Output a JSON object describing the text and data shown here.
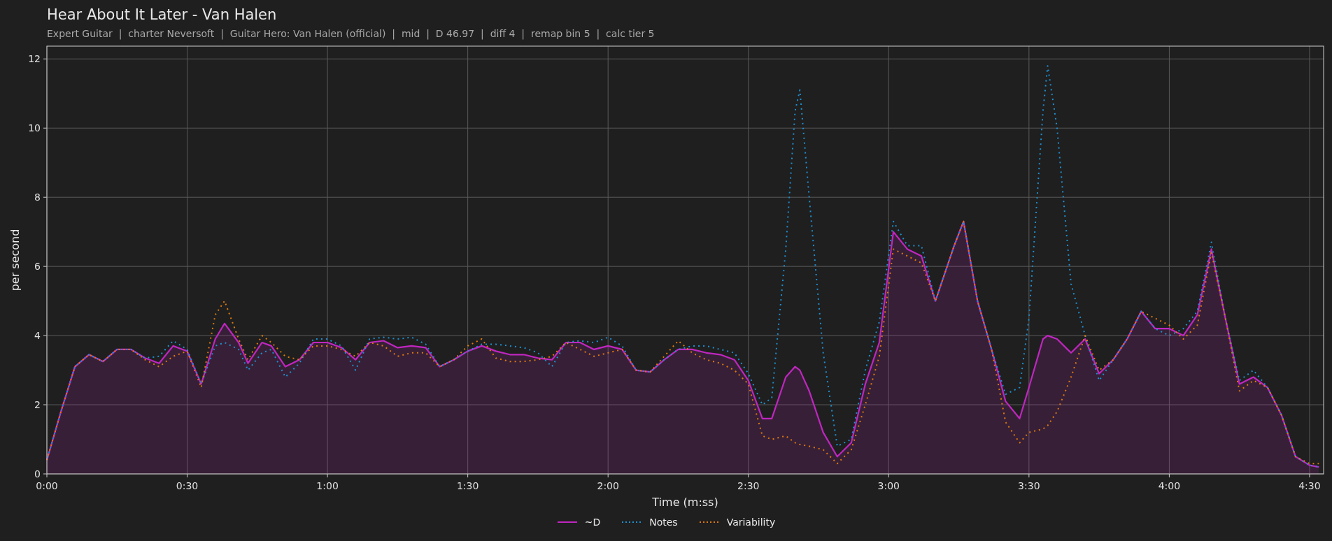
{
  "chart": {
    "subtitle": "Expert Guitar  |  charter Neversoft  |  Guitar Hero: Van Halen (official)  |  mid  |  D 46.97  |  diff 4  |  remap bin 5  |  calc tier 5",
    "chart_data": {
      "type": "line",
      "grid": true,
      "title": "Hear About It Later - Van Halen",
      "xlabel": "Time (m:ss)",
      "ylabel": "per second",
      "x": [
        0,
        3,
        6,
        9,
        12,
        15,
        18,
        21,
        24,
        27,
        30,
        33,
        36,
        38,
        41,
        43,
        46,
        48,
        51,
        54,
        57,
        60,
        63,
        66,
        69,
        72,
        75,
        78,
        81,
        84,
        87,
        90,
        93,
        96,
        99,
        102,
        105,
        108,
        111,
        114,
        117,
        120,
        123,
        126,
        129,
        132,
        135,
        138,
        141,
        144,
        147,
        150,
        153,
        155,
        158,
        160,
        161,
        163,
        166,
        169,
        172,
        175,
        178,
        181,
        184,
        187,
        190,
        194,
        196,
        199,
        202,
        205,
        208,
        210,
        213,
        214,
        216,
        219,
        222,
        225,
        228,
        231,
        234,
        237,
        240,
        243,
        246,
        249,
        252,
        255,
        258,
        261,
        264,
        267,
        270,
        272
      ],
      "series": [
        {
          "name": "~D",
          "color": "#c026c0",
          "type": "area",
          "line_style": "solid",
          "values": [
            0.4,
            1.8,
            3.1,
            3.45,
            3.25,
            3.6,
            3.6,
            3.35,
            3.2,
            3.7,
            3.55,
            2.6,
            3.9,
            4.35,
            3.8,
            3.2,
            3.8,
            3.7,
            3.1,
            3.3,
            3.8,
            3.8,
            3.65,
            3.3,
            3.8,
            3.85,
            3.65,
            3.7,
            3.65,
            3.1,
            3.3,
            3.55,
            3.7,
            3.55,
            3.45,
            3.45,
            3.35,
            3.3,
            3.8,
            3.8,
            3.6,
            3.7,
            3.6,
            3.0,
            2.95,
            3.3,
            3.6,
            3.6,
            3.5,
            3.45,
            3.3,
            2.7,
            1.6,
            1.6,
            2.8,
            3.1,
            3.0,
            2.4,
            1.2,
            0.5,
            0.9,
            2.6,
            3.8,
            7.0,
            6.5,
            6.3,
            5.0,
            6.6,
            7.3,
            5.0,
            3.6,
            2.1,
            1.6,
            2.5,
            3.9,
            4.0,
            3.9,
            3.5,
            3.9,
            2.9,
            3.3,
            3.9,
            4.7,
            4.2,
            4.2,
            4.0,
            4.6,
            6.5,
            4.5,
            2.6,
            2.8,
            2.5,
            1.7,
            0.5,
            0.25,
            0.2
          ]
        },
        {
          "name": "Notes",
          "color": "#1f8fcf",
          "type": "line",
          "line_style": "dotted",
          "values": [
            0.4,
            1.8,
            3.1,
            3.45,
            3.25,
            3.6,
            3.6,
            3.35,
            3.4,
            3.85,
            3.6,
            2.6,
            3.7,
            3.8,
            3.6,
            3.0,
            3.5,
            3.6,
            2.8,
            3.2,
            3.9,
            3.9,
            3.7,
            3.0,
            3.9,
            3.95,
            3.9,
            3.95,
            3.75,
            3.1,
            3.3,
            3.55,
            3.75,
            3.75,
            3.7,
            3.65,
            3.5,
            3.1,
            3.8,
            3.85,
            3.8,
            3.95,
            3.7,
            3.0,
            2.95,
            3.3,
            3.6,
            3.7,
            3.7,
            3.6,
            3.5,
            2.9,
            2.0,
            2.2,
            6.5,
            10.5,
            11.1,
            8.0,
            3.5,
            0.8,
            1.0,
            3.0,
            4.4,
            7.3,
            6.6,
            6.6,
            5.0,
            6.6,
            7.3,
            5.0,
            3.6,
            2.3,
            2.5,
            4.5,
            10.5,
            11.8,
            10.0,
            5.5,
            4.0,
            2.7,
            3.3,
            3.9,
            4.7,
            4.2,
            4.0,
            4.2,
            4.7,
            6.7,
            4.5,
            2.7,
            3.0,
            2.5,
            1.7,
            0.5,
            0.25,
            0.2
          ]
        },
        {
          "name": "Variability",
          "color": "#e0780f",
          "type": "line",
          "line_style": "dotted",
          "values": [
            0.4,
            1.8,
            3.1,
            3.45,
            3.25,
            3.6,
            3.6,
            3.3,
            3.1,
            3.4,
            3.55,
            2.5,
            4.6,
            5.0,
            3.9,
            3.3,
            4.0,
            3.8,
            3.4,
            3.3,
            3.7,
            3.7,
            3.6,
            3.4,
            3.8,
            3.7,
            3.4,
            3.5,
            3.5,
            3.1,
            3.3,
            3.7,
            3.9,
            3.35,
            3.25,
            3.25,
            3.3,
            3.4,
            3.8,
            3.6,
            3.4,
            3.5,
            3.6,
            3.0,
            2.95,
            3.4,
            3.85,
            3.5,
            3.3,
            3.2,
            3.0,
            2.6,
            1.1,
            1.0,
            1.1,
            0.9,
            0.85,
            0.8,
            0.7,
            0.3,
            0.7,
            2.0,
            3.4,
            6.5,
            6.3,
            6.1,
            5.0,
            6.6,
            7.3,
            5.0,
            3.6,
            1.5,
            0.9,
            1.2,
            1.3,
            1.4,
            1.8,
            2.8,
            4.0,
            3.0,
            3.3,
            3.9,
            4.7,
            4.5,
            4.3,
            3.9,
            4.3,
            6.4,
            4.5,
            2.4,
            2.7,
            2.5,
            1.7,
            0.5,
            0.3,
            0.3
          ]
        }
      ],
      "xlim": [
        0,
        273
      ],
      "ylim": [
        0,
        12.37
      ],
      "xticks": [
        {
          "value": 0,
          "label": "0:00"
        },
        {
          "value": 30,
          "label": "0:30"
        },
        {
          "value": 60,
          "label": "1:00"
        },
        {
          "value": 90,
          "label": "1:30"
        },
        {
          "value": 120,
          "label": "2:00"
        },
        {
          "value": 150,
          "label": "2:30"
        },
        {
          "value": 180,
          "label": "3:00"
        },
        {
          "value": 210,
          "label": "3:30"
        },
        {
          "value": 240,
          "label": "4:00"
        },
        {
          "value": 270,
          "label": "4:30"
        }
      ],
      "yticks": [
        0,
        2,
        4,
        6,
        8,
        10,
        12
      ]
    }
  }
}
